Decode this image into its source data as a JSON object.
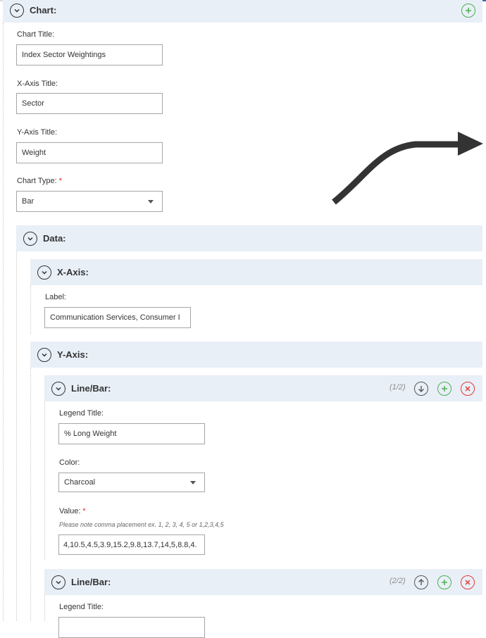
{
  "chart_section": {
    "title": "Chart:",
    "chart_title_label": "Chart Title:",
    "chart_title_value": "Index Sector Weightings",
    "x_axis_title_label": "X-Axis Title:",
    "x_axis_title_value": "Sector",
    "y_axis_title_label": "Y-Axis Title:",
    "y_axis_title_value": "Weight",
    "chart_type_label": "Chart Type:",
    "chart_type_required": "*",
    "chart_type_value": "Bar"
  },
  "data_section": {
    "title": "Data:",
    "x_axis": {
      "title": "X-Axis:",
      "label_caption": "Label:",
      "label_value": "Communication Services, Consumer I"
    },
    "y_axis": {
      "title": "Y-Axis:",
      "series": [
        {
          "title": "Line/Bar:",
          "counter": "(1/2)",
          "legend_title_label": "Legend Title:",
          "legend_title_value": "% Long Weight",
          "color_label": "Color:",
          "color_value": "Charcoal",
          "value_label": "Value:",
          "value_required": "*",
          "value_hint": "Please note comma placement ex. 1, 2, 3, 4, 5 or 1,2,3,4,5",
          "value_value": "4,10.5,4.5,3.9,15.2,9.8,13.7,14,5,8.8,4."
        },
        {
          "title": "Line/Bar:",
          "counter": "(2/2)",
          "legend_title_label": "Legend Title:"
        }
      ]
    }
  },
  "colors": {
    "header_bg": "#e9eff7",
    "add_green": "#4caf50",
    "remove_red": "#e53935",
    "required_red": "#d22",
    "arrow_annotation": "#333333"
  }
}
